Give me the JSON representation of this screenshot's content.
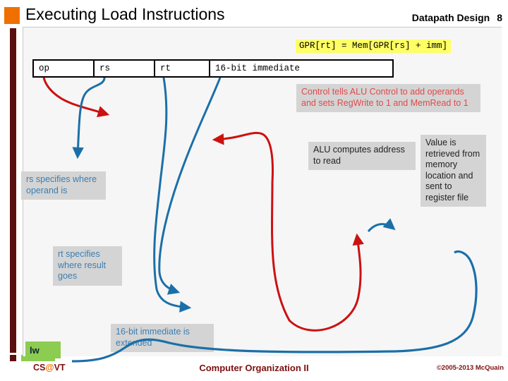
{
  "header": {
    "title": "Executing Load Instructions",
    "subject": "Datapath Design",
    "slide_number": "8",
    "bullet_color": "#ef7000"
  },
  "formula": {
    "text": "GPR[rt] = Mem[GPR[rs] + imm]",
    "highlight_color": "#ffff66"
  },
  "instruction_format": {
    "fields": [
      {
        "label": "op"
      },
      {
        "label": "rs"
      },
      {
        "label": "rt"
      },
      {
        "label": "16-bit immediate"
      }
    ]
  },
  "callouts": [
    {
      "id": "control",
      "text": "Control tells ALU Control to add operands and sets RegWrite to 1 and MemRead to 1",
      "color": "#e04a4a"
    },
    {
      "id": "alu",
      "text": "ALU computes address to read",
      "color": "#222222"
    },
    {
      "id": "value",
      "text": "Value is retrieved from memory location and sent to register file",
      "color": "#222222"
    },
    {
      "id": "rs",
      "text": "rs specifies where operand is",
      "color": "#3a7fb5"
    },
    {
      "id": "rt",
      "text": "rt specifies where result goes",
      "color": "#3a7fb5"
    },
    {
      "id": "immediate",
      "text": "16-bit immediate is extended",
      "color": "#3a7fb5"
    }
  ],
  "instruction_tag": {
    "label": "lw",
    "background_color": "#8ccc50"
  },
  "arrows": {
    "red_color": "#cc1111",
    "blue_color": "#1b6fa8"
  },
  "footer": {
    "left_prefix": "CS",
    "left_at": "@",
    "left_suffix": "VT",
    "center": "Computer Organization II",
    "right": "©2005-2013 McQuain",
    "color": "#7d1010"
  }
}
